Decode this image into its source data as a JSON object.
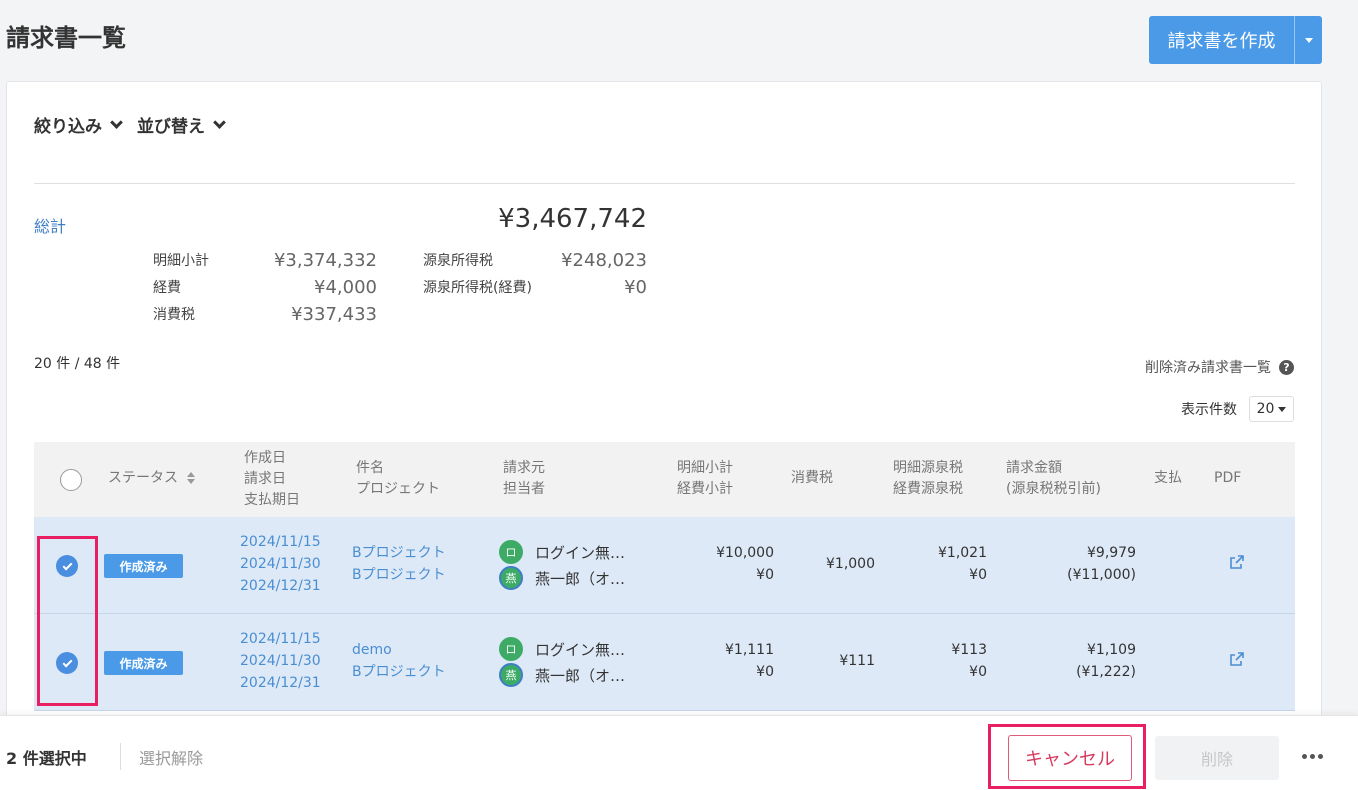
{
  "page": {
    "title": "請求書一覧"
  },
  "create_button": {
    "label": "請求書を作成"
  },
  "filters": {
    "filter_label": "絞り込み",
    "sort_label": "並び替え"
  },
  "summary": {
    "total_label": "総計",
    "total_value": "¥3,467,742",
    "items": [
      {
        "label": "明細小計",
        "value": "¥3,374,332"
      },
      {
        "label": "経費",
        "value": "¥4,000"
      },
      {
        "label": "消費税",
        "value": "¥337,433"
      },
      {
        "label": "源泉所得税",
        "value": "¥248,023"
      },
      {
        "label": "源泉所得税(経費)",
        "value": "¥0"
      }
    ]
  },
  "list_info": {
    "count": "20 件 / 48 件",
    "deleted_link": "削除済み請求書一覧",
    "per_page_label": "表示件数",
    "per_page_value": "20"
  },
  "table": {
    "headers": {
      "status": "ステータス",
      "dates": [
        "作成日",
        "請求日",
        "支払期日"
      ],
      "subject": [
        "件名",
        "プロジェクト"
      ],
      "issuer": [
        "請求元",
        "担当者"
      ],
      "subtotal": [
        "明細小計",
        "経費小計"
      ],
      "tax": "消費税",
      "withholding": [
        "明細源泉税",
        "経費源泉税"
      ],
      "amount": [
        "請求金額",
        "(源泉税税引前)"
      ],
      "payment": "支払",
      "pdf": "PDF"
    },
    "rows": [
      {
        "status": "作成済み",
        "dates": [
          "2024/11/15",
          "2024/11/30",
          "2024/12/31"
        ],
        "subject": "Bプロジェクト",
        "project": "Bプロジェクト",
        "issuer_avatar": "ロ",
        "issuer": "ログイン無…",
        "person_avatar": "燕",
        "person": "燕一郎（オ…",
        "subtotal": "¥10,000",
        "expense": "¥0",
        "tax": "¥1,000",
        "withholding": "¥1,021",
        "withholding_expense": "¥0",
        "amount": "¥9,979",
        "amount_pretax": "(¥11,000)"
      },
      {
        "status": "作成済み",
        "dates": [
          "2024/11/15",
          "2024/11/30",
          "2024/12/31"
        ],
        "subject": "demo",
        "project": "Bプロジェクト",
        "issuer_avatar": "ロ",
        "issuer": "ログイン無…",
        "person_avatar": "燕",
        "person": "燕一郎（オ…",
        "subtotal": "¥1,111",
        "expense": "¥0",
        "tax": "¥111",
        "withholding": "¥113",
        "withholding_expense": "¥0",
        "amount": "¥1,109",
        "amount_pretax": "(¥1,222)"
      }
    ]
  },
  "footer": {
    "selected": "2 件選択中",
    "deselect": "選択解除",
    "cancel": "キャンセル",
    "delete": "削除"
  },
  "colors": {
    "accent": "#4a9ae8",
    "selected_row": "#dde9f7",
    "highlight": "#e91e63",
    "cancel": "#d63a5e"
  }
}
